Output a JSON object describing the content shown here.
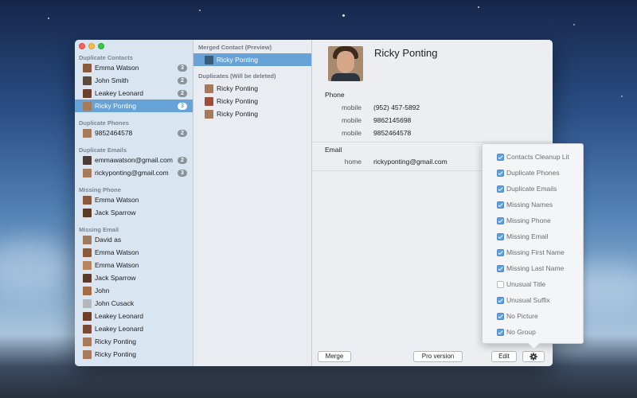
{
  "sidebar": {
    "groups": [
      {
        "title": "Duplicate Contacts",
        "items": [
          {
            "label": "Emma Watson",
            "badge": "3",
            "avatar_color": "#8a5a3c"
          },
          {
            "label": "John Smith",
            "badge": "2",
            "avatar_color": "#5c4a3e"
          },
          {
            "label": "Leakey Leonard",
            "badge": "2",
            "avatar_color": "#6b3f2c"
          },
          {
            "label": "Ricky Ponting",
            "badge": "3",
            "avatar_color": "#a77a5c",
            "selected": true
          }
        ]
      },
      {
        "title": "Duplicate Phones",
        "items": [
          {
            "label": "9852464578",
            "badge": "2",
            "avatar_color": "#a77a5c"
          }
        ]
      },
      {
        "title": "Duplicate Emails",
        "items": [
          {
            "label": "emmawatson@gmail.com",
            "badge": "2",
            "avatar_color": "#4c3a36"
          },
          {
            "label": "rickyponting@gmail.com",
            "badge": "3",
            "avatar_color": "#a77a5c"
          }
        ]
      },
      {
        "title": "Missing Phone",
        "items": [
          {
            "label": "Emma Watson",
            "avatar_color": "#8a5a3c"
          },
          {
            "label": "Jack Sparrow",
            "avatar_color": "#5b3b28"
          }
        ]
      },
      {
        "title": "Missing Email",
        "items": [
          {
            "label": "David as",
            "avatar_color": "#9c7a62"
          },
          {
            "label": "Emma Watson",
            "avatar_color": "#8a5a3c"
          },
          {
            "label": "Emma Watson",
            "avatar_color": "#b8865e"
          },
          {
            "label": "Jack Sparrow",
            "avatar_color": "#5b3b28"
          },
          {
            "label": "John",
            "avatar_color": "#a26c45"
          },
          {
            "label": "John Cusack",
            "avatar_color": "#b4b8bd"
          },
          {
            "label": "Leakey Leonard",
            "avatar_color": "#6b3f2c"
          },
          {
            "label": "Leakey Leonard",
            "avatar_color": "#7a4a36"
          },
          {
            "label": "Ricky Ponting",
            "avatar_color": "#a77a5c"
          },
          {
            "label": "Ricky Ponting",
            "avatar_color": "#a77a5c"
          }
        ]
      }
    ]
  },
  "middle": {
    "merged_title": "Merged Contact (Preview)",
    "merged_items": [
      {
        "label": "Ricky Ponting",
        "avatar_color": "#3a5a7a",
        "selected": true
      }
    ],
    "duplicates_title": "Duplicates (Will be deleted)",
    "duplicate_items": [
      {
        "label": "Ricky Ponting",
        "avatar_color": "#a77a5c"
      },
      {
        "label": "Ricky Ponting",
        "avatar_color": "#a04c3c"
      },
      {
        "label": "Ricky Ponting",
        "avatar_color": "#a77a5c"
      }
    ]
  },
  "detail": {
    "name": "Ricky Ponting",
    "phone_section": "Phone",
    "phones": [
      {
        "label": "mobile",
        "value": "(952) 457-5892"
      },
      {
        "label": "mobile",
        "value": "9862145698"
      },
      {
        "label": "mobile",
        "value": "9852464578"
      }
    ],
    "email_section": "Email",
    "emails": [
      {
        "label": "home",
        "value": "rickyponting@gmail.com"
      }
    ]
  },
  "buttons": {
    "merge": "Merge",
    "pro": "Pro version",
    "edit": "Edit",
    "gear_icon": "gear-icon"
  },
  "popover": {
    "options": [
      {
        "label": "Contacts Cleanup Lit",
        "checked": true
      },
      {
        "label": "Duplicate Phones",
        "checked": true
      },
      {
        "label": "Duplicate Emails",
        "checked": true
      },
      {
        "label": "Missing Names",
        "checked": true
      },
      {
        "label": "Missing Phone",
        "checked": true
      },
      {
        "label": "Missing Email",
        "checked": true
      },
      {
        "label": "Missing First Name",
        "checked": true
      },
      {
        "label": "Missing Last Name",
        "checked": true
      },
      {
        "label": "Unusual Title",
        "checked": false
      },
      {
        "label": "Unusual Suffix",
        "checked": true
      },
      {
        "label": "No Picture",
        "checked": true
      },
      {
        "label": "No Group",
        "checked": true
      }
    ]
  },
  "colors": {
    "selection": "#67a3d6",
    "badge": "#8a929c",
    "checkbox": "#5a9ee3"
  }
}
